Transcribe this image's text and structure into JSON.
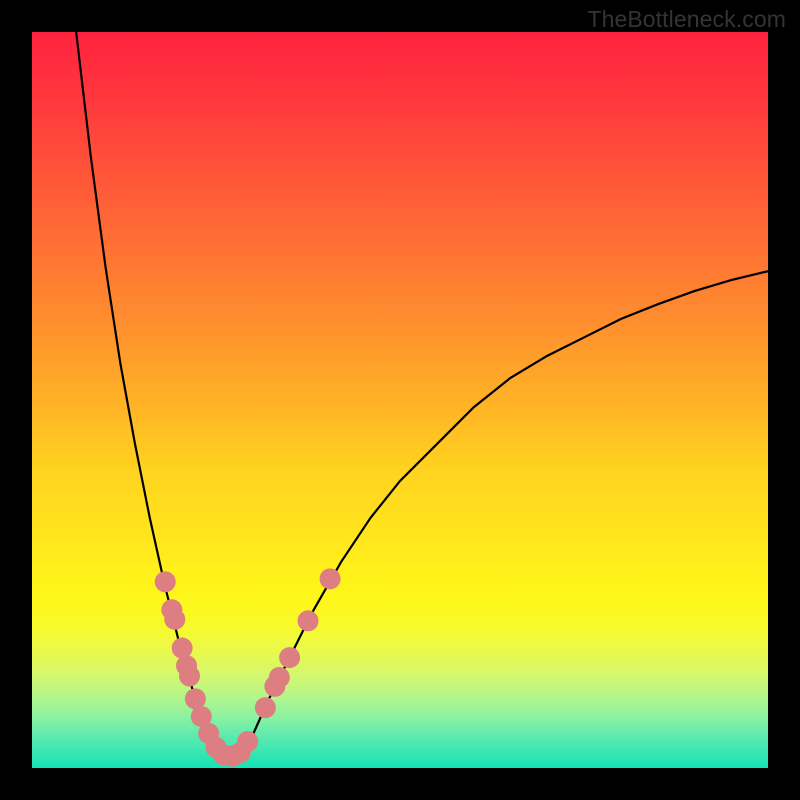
{
  "chart_data": {
    "type": "line",
    "title": "",
    "xlabel": "",
    "ylabel": "",
    "xlim": [
      0,
      100
    ],
    "ylim": [
      0,
      100
    ],
    "description": "V-shaped bottleneck curve: left branch falls steeply from top-left toward a minimum near x≈26, right branch rises and asymptotes near y≈68 at far right. A cluster of salmon-colored markers straddles the minimum.",
    "left_branch": {
      "x": [
        6,
        8,
        10,
        12,
        14,
        16,
        18,
        20,
        22,
        23,
        24,
        25,
        26
      ],
      "y": [
        100,
        83,
        68,
        55,
        44,
        34,
        25,
        17,
        10,
        7,
        5,
        3,
        1.8
      ]
    },
    "right_branch": {
      "x": [
        28,
        30,
        32,
        35,
        38,
        42,
        46,
        50,
        55,
        60,
        65,
        70,
        75,
        80,
        85,
        90,
        95,
        100
      ],
      "y": [
        2,
        4.5,
        9,
        15,
        21,
        28,
        34,
        39,
        44,
        49,
        53,
        56,
        58.5,
        61,
        63,
        64.8,
        66.3,
        67.5
      ]
    },
    "markers": [
      {
        "x": 18.1,
        "y": 25.3
      },
      {
        "x": 19.0,
        "y": 21.5
      },
      {
        "x": 19.4,
        "y": 20.2
      },
      {
        "x": 20.4,
        "y": 16.3
      },
      {
        "x": 21.0,
        "y": 13.9
      },
      {
        "x": 21.4,
        "y": 12.5
      },
      {
        "x": 22.2,
        "y": 9.4
      },
      {
        "x": 23.0,
        "y": 7.0
      },
      {
        "x": 24.0,
        "y": 4.7
      },
      {
        "x": 25.0,
        "y": 2.8
      },
      {
        "x": 26.0,
        "y": 1.8
      },
      {
        "x": 27.2,
        "y": 1.6
      },
      {
        "x": 28.3,
        "y": 2.1
      },
      {
        "x": 29.3,
        "y": 3.6
      },
      {
        "x": 31.7,
        "y": 8.2
      },
      {
        "x": 33.0,
        "y": 11.1
      },
      {
        "x": 33.6,
        "y": 12.3
      },
      {
        "x": 35.0,
        "y": 15.0
      },
      {
        "x": 37.5,
        "y": 20.0
      },
      {
        "x": 40.5,
        "y": 25.7
      }
    ],
    "credit": "TheBottleneck.com",
    "marker_radius_px": 10.5,
    "colors": {
      "curve": "#000000",
      "markers": "#dc7e82",
      "frame": "#000000"
    }
  }
}
